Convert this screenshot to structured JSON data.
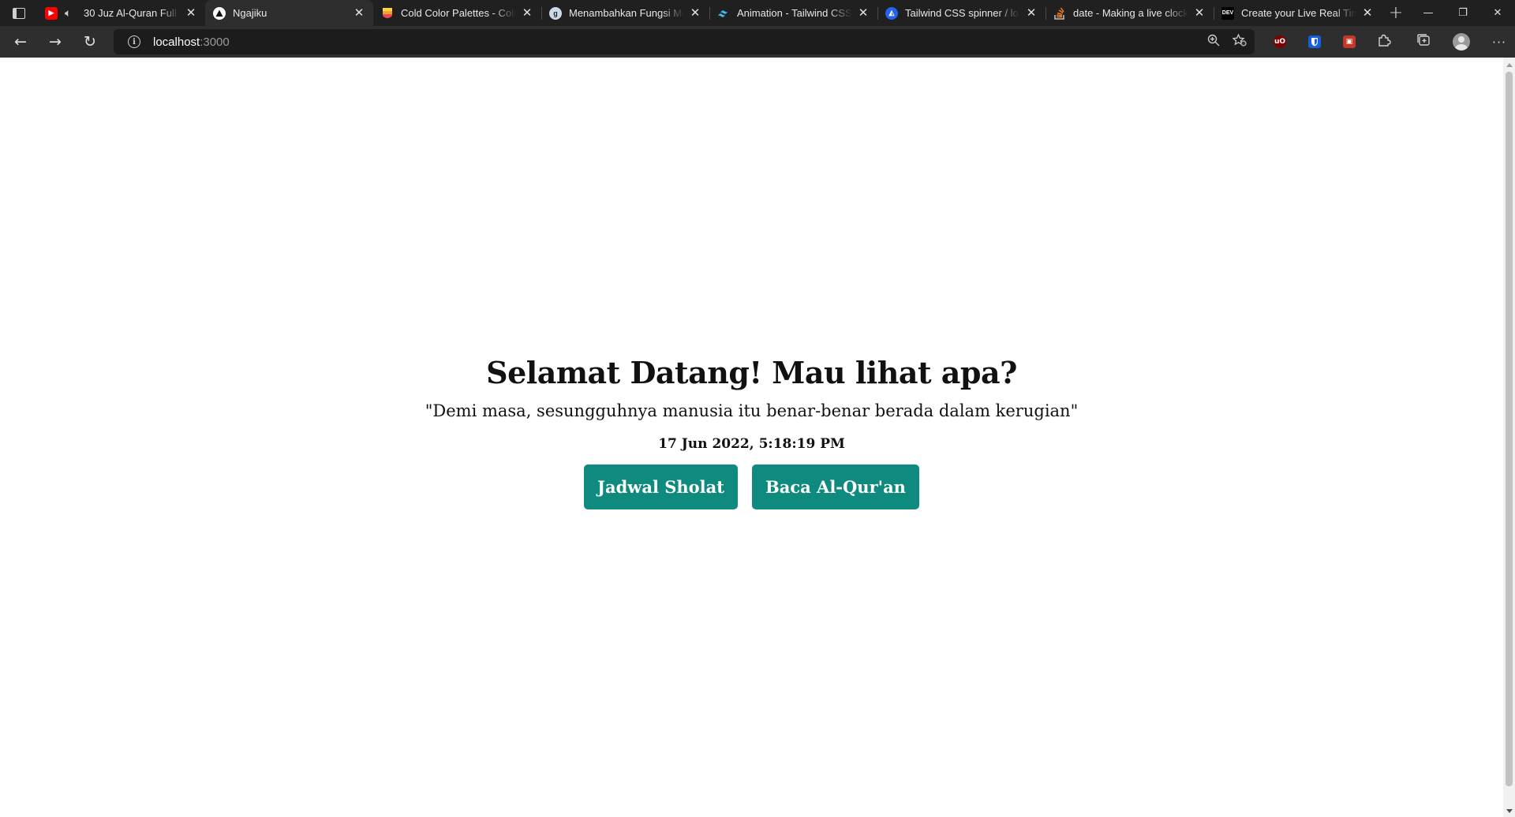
{
  "browser": {
    "tabs": [
      {
        "title": "30 Juz Al-Quran Full",
        "favicon": "youtube-icon",
        "favicon_color": "#ff0000",
        "audio": true,
        "active": false
      },
      {
        "title": "Ngajiku",
        "favicon": "triangle-icon",
        "favicon_color": "#ffffff",
        "audio": false,
        "active": true
      },
      {
        "title": "Cold Color Palettes - Color Hunt",
        "favicon": "palette-icon",
        "favicon_color": "#f2c12e",
        "audio": false,
        "active": false
      },
      {
        "title": "Menambahkan Fungsi Module",
        "favicon": "g-icon",
        "favicon_color": "#cfd8e6",
        "audio": false,
        "active": false
      },
      {
        "title": "Animation - Tailwind CSS",
        "favicon": "tailwind-icon",
        "favicon_color": "#38bdf8",
        "audio": false,
        "active": false
      },
      {
        "title": "Tailwind CSS spinner / loader",
        "favicon": "flowbite-icon",
        "favicon_color": "#2563eb",
        "audio": false,
        "active": false
      },
      {
        "title": "date - Making a live clock",
        "favicon": "stackoverflow-icon",
        "favicon_color": "#f48024",
        "audio": false,
        "active": false
      },
      {
        "title": "Create your Live Real Time Clock",
        "favicon": "dev-icon",
        "favicon_color": "#ffffff",
        "audio": false,
        "active": false
      }
    ],
    "address": {
      "host": "localhost",
      "port": ":3000"
    },
    "extensions": [
      {
        "name": "ublock-icon",
        "color": "#800000",
        "label": "uO"
      },
      {
        "name": "bitwarden-icon",
        "color": "#175ddc",
        "label": ""
      },
      {
        "name": "extension-red-icon",
        "color": "#c0392b",
        "label": ""
      }
    ]
  },
  "page": {
    "title": "Selamat Datang! Mau lihat apa?",
    "quote": "\"Demi masa, sesungguhnya manusia itu benar-benar berada dalam kerugian\"",
    "clock": "17 Jun 2022, 5:18:19 PM",
    "buttons": {
      "jadwal": "Jadwal Sholat",
      "quran": "Baca Al-Qur'an"
    },
    "accent_color": "#0f8a7e"
  }
}
